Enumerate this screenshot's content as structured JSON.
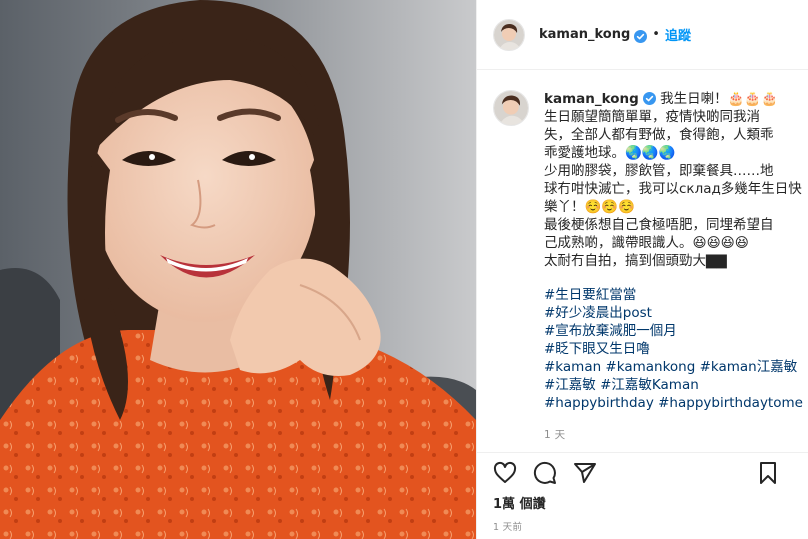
{
  "post": {
    "username": "kaman_kong",
    "follow_label": "追蹤",
    "dot": "•",
    "caption_lines": [
      "我生日喇！🎂🎂🎂",
      "生日願望簡簡單單，疫情快啲同我消",
      "失，全部人都有野做，食得飽，人類乖",
      "乖愛護地球。🌏🌏🌏",
      "少用啲膠袋，膠飲管，即棄餐具……地",
      "球冇咁快滅亡，我可以склад多幾年生日快",
      "樂丫！☺️☺️☺️",
      "最後梗係想自己食極唔肥，同埋希望自",
      "己成熟啲，識帶眼識人。😆😆😆😆",
      "太耐冇自拍，搞到個頭勁大▇▇"
    ],
    "hashtags": [
      "#生日要紅當當",
      "#好少凌晨出post",
      "#宣布放棄減肥一個月",
      "#眨下眼又生日嚕",
      "#kaman #kamankong #kaman江嘉敏",
      "#江嘉敏 #江嘉敏Kaman",
      "#happybirthday #happybirthdaytome"
    ],
    "caption_time": "1 天",
    "likes": "1萬 個讚",
    "post_time": "1 天前"
  },
  "colors": {
    "link": "#0095f6",
    "hashtag": "#00376b",
    "muted": "#8e8e8e",
    "text": "#262626",
    "dress": "#e0521f"
  },
  "icons": {
    "like": "heart-icon",
    "comment": "comment-icon",
    "share": "share-icon",
    "save": "bookmark-icon",
    "verified": "verified-badge-icon"
  }
}
